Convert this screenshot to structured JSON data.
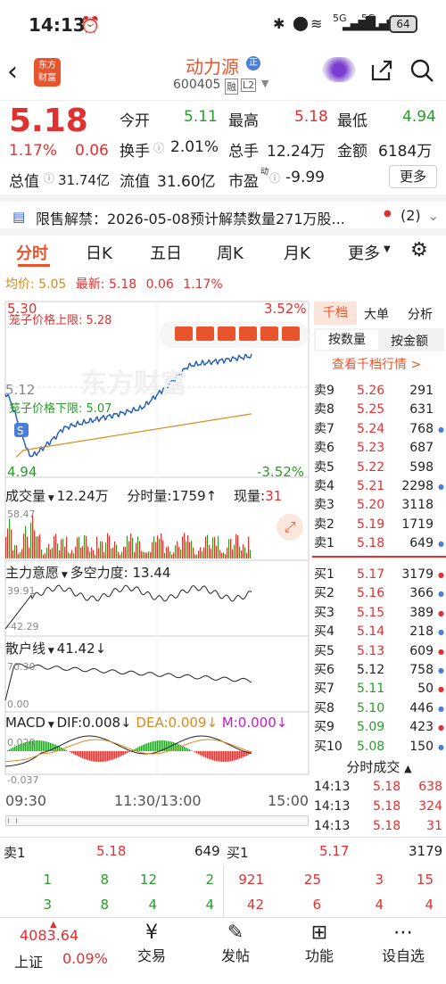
{
  "status": {
    "time": "14:13",
    "net1": "5G",
    "net2": "5G",
    "battery": "64"
  },
  "header": {
    "logo_line1": "东方",
    "logo_line2": "财富",
    "name": "动力源",
    "badge": "正",
    "code": "600405",
    "tag1": "融",
    "tag2": "L2"
  },
  "quote": {
    "price": "5.18",
    "pct": "1.17%",
    "chg": "0.06",
    "open_label": "今开",
    "open": "5.11",
    "high_label": "最高",
    "high": "5.18",
    "low_label": "最低",
    "low": "4.94",
    "turnover_label": "换手",
    "turnover": "2.01%",
    "volume_label": "总手",
    "volume": "12.24万",
    "amount_label": "金额",
    "amount": "6184万",
    "mcap_label": "总值",
    "mcap": "31.74亿",
    "float_label": "流值",
    "float": "31.60亿",
    "pe_label": "市盈",
    "pe_sup": "动",
    "pe": "-9.99",
    "more_btn": "更多"
  },
  "notice": {
    "text": "限售解禁：2026-05-08预计解禁数量271万股...",
    "count": "(2)"
  },
  "tabs": [
    "分时",
    "日K",
    "五日",
    "周K",
    "月K",
    "更多"
  ],
  "chartinfo": {
    "avg_label": "均价:",
    "avg": "5.05",
    "last_label": "最新:",
    "last": "5.18",
    "chg": "0.06",
    "pct": "1.17%"
  },
  "price_axis": {
    "top": "5.30",
    "mid": "5.12",
    "bottom": "4.94",
    "pct_top": "3.52%",
    "pct_bottom": "-3.52%"
  },
  "limit_upper": "笼子价格上限: 5.28",
  "limit_lower": "笼子价格下限: 5.07",
  "volume": {
    "label": "成交量",
    "total": "12.24万",
    "fen_label": "分时量:",
    "fen": "1759↑",
    "now_label": "现量:",
    "now": "31",
    "axis": "58.47"
  },
  "zhuli": {
    "label": "主力意愿",
    "power_label": "多空力度:",
    "power": "13.44",
    "top": "39.91",
    "bottom": "-42.29"
  },
  "sanhu": {
    "label": "散户线",
    "value": "41.42↓",
    "top": "70.30",
    "bottom": "0.00"
  },
  "macd": {
    "label": "MACD",
    "dif": "DIF:0.008↓",
    "dea": "DEA:0.009↓",
    "m": "M:0.000↓",
    "top": "0.020",
    "bottom": "-0.037"
  },
  "time_axis": [
    "09:30",
    "11:30/13:00",
    "15:00"
  ],
  "panel": {
    "tab1": "千档",
    "tab2": "大单",
    "tab3": "分析",
    "sub1": "按数量",
    "sub2": "按金额",
    "link": "查看千档行情 >"
  },
  "sells": [
    {
      "label": "卖9",
      "price": "5.26",
      "vol": "291"
    },
    {
      "label": "卖8",
      "price": "5.25",
      "vol": "631"
    },
    {
      "label": "卖7",
      "price": "5.24",
      "vol": "768"
    },
    {
      "label": "卖6",
      "price": "5.23",
      "vol": "687"
    },
    {
      "label": "卖5",
      "price": "5.22",
      "vol": "598"
    },
    {
      "label": "卖4",
      "price": "5.21",
      "vol": "2298"
    },
    {
      "label": "卖3",
      "price": "5.20",
      "vol": "3118"
    },
    {
      "label": "卖2",
      "price": "5.19",
      "vol": "1719"
    },
    {
      "label": "卖1",
      "price": "5.18",
      "vol": "649"
    }
  ],
  "buys": [
    {
      "label": "买1",
      "price": "5.17",
      "vol": "3179"
    },
    {
      "label": "买2",
      "price": "5.16",
      "vol": "366"
    },
    {
      "label": "买3",
      "price": "5.15",
      "vol": "389"
    },
    {
      "label": "买4",
      "price": "5.14",
      "vol": "218"
    },
    {
      "label": "买5",
      "price": "5.13",
      "vol": "609"
    },
    {
      "label": "买6",
      "price": "5.12",
      "vol": "758"
    },
    {
      "label": "买7",
      "price": "5.11",
      "vol": "50"
    },
    {
      "label": "买8",
      "price": "5.10",
      "vol": "446"
    },
    {
      "label": "买9",
      "price": "5.09",
      "vol": "423"
    },
    {
      "label": "买10",
      "price": "5.08",
      "vol": "150"
    }
  ],
  "ticks_title": "分时成交",
  "ticks": [
    {
      "t": "14:13",
      "p": "5.18",
      "v": "638"
    },
    {
      "t": "14:13",
      "p": "5.18",
      "v": "324"
    },
    {
      "t": "14:13",
      "p": "5.18",
      "v": "31"
    }
  ],
  "bottom": {
    "s1_label": "卖1",
    "s1_price": "5.18",
    "s1_vol": "649",
    "b1_label": "买1",
    "b1_price": "5.17",
    "b1_vol": "3179",
    "row1": [
      "1",
      "8",
      "12",
      "2",
      "921",
      "25",
      "3",
      "15"
    ],
    "row2": [
      "3",
      "8",
      "4",
      "4",
      "42",
      "6",
      "4",
      "4"
    ]
  },
  "nav": {
    "index_value": "4083.64",
    "index_name": "上证",
    "index_pct": "0.09%",
    "items": [
      "交易",
      "发帖",
      "功能",
      "设自选"
    ]
  }
}
